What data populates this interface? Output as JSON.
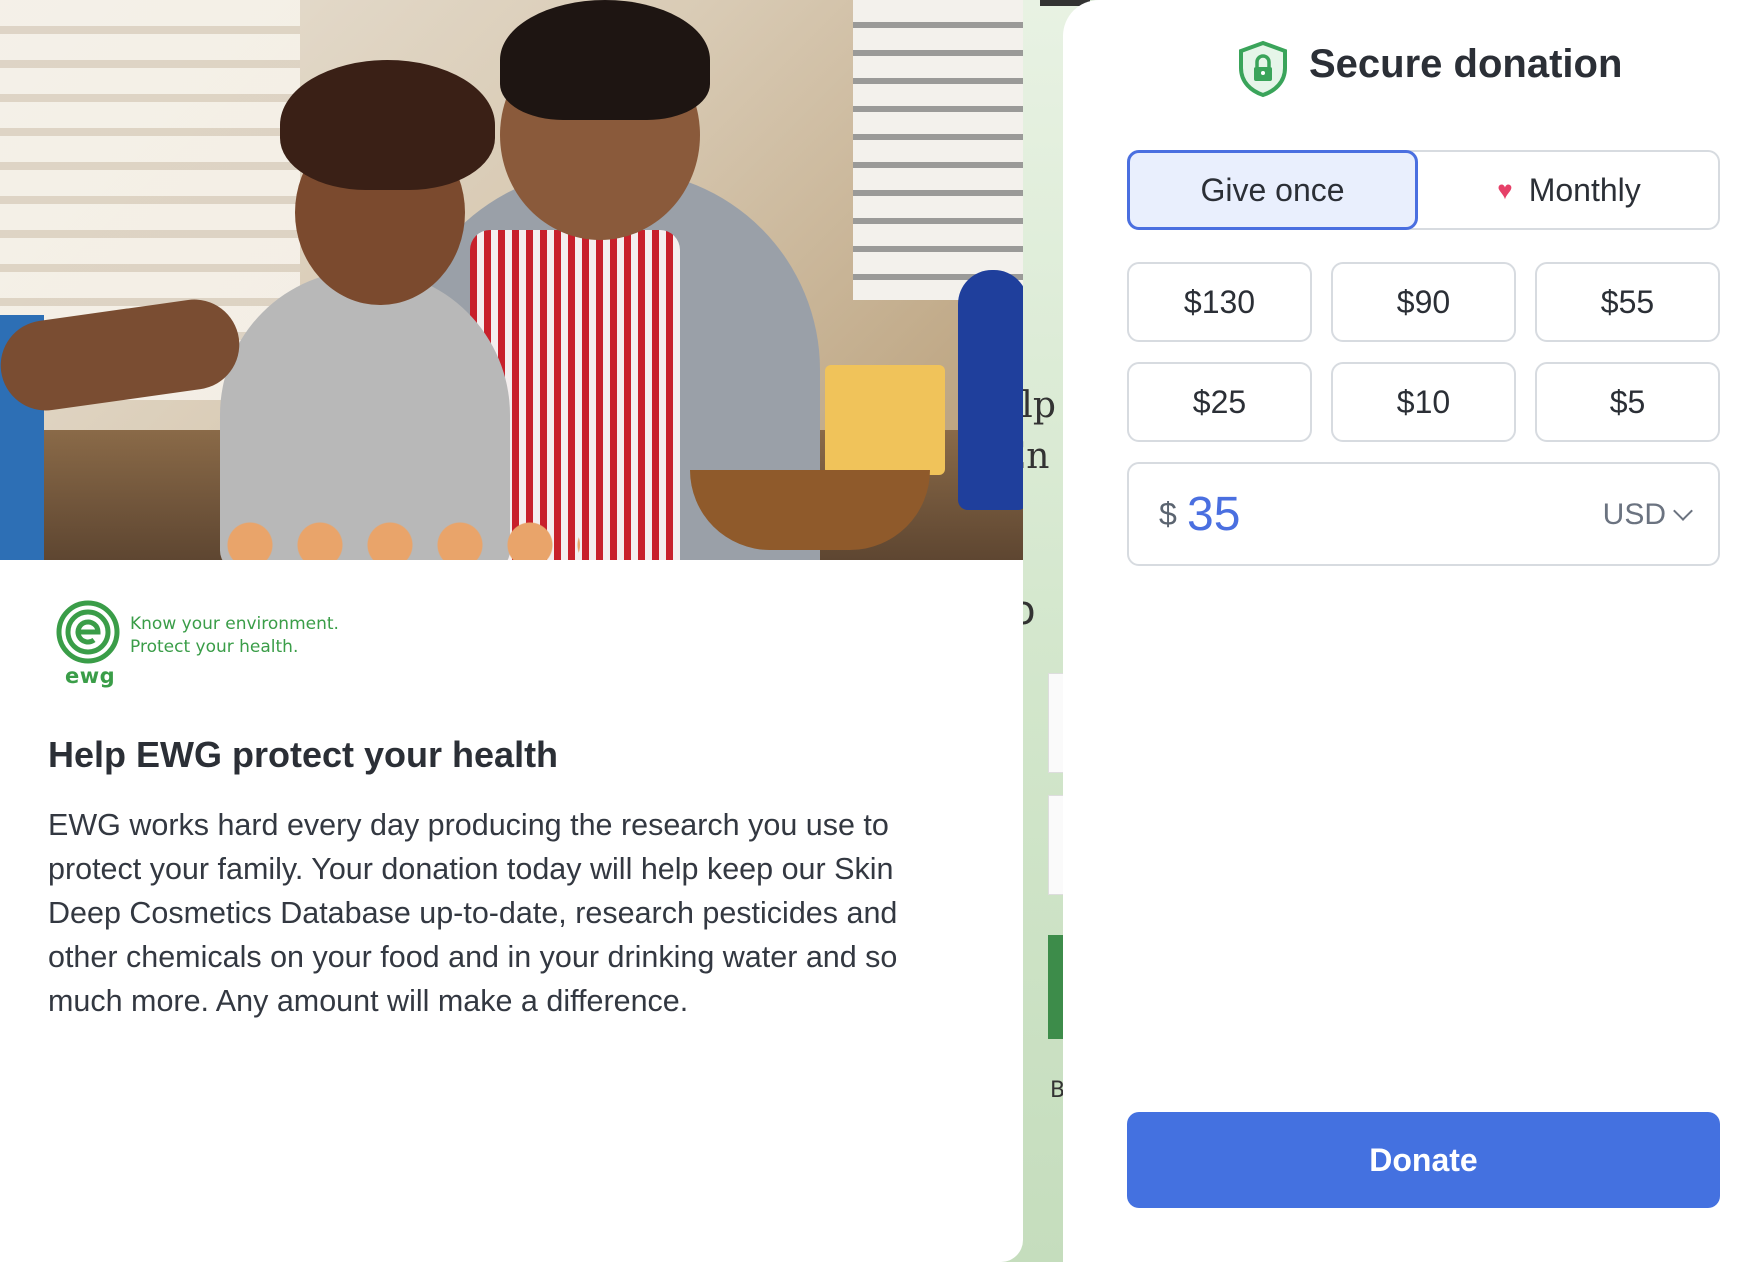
{
  "background_page": {
    "fragments": [
      "elp",
      "En",
      "lo",
      "B"
    ]
  },
  "story": {
    "hero_image": "parent-and-child-cooking-photo",
    "logo": {
      "word": "ewg",
      "tagline_line1": "Know your environment.",
      "tagline_line2": "Protect your health."
    },
    "title": "Help EWG protect your health",
    "body": "EWG works hard every day producing the research you use to protect your family. Your donation today will help keep our Skin Deep Cosmetics Database up-to-date, research pesticides and other chemicals on your food and in your drinking water and so much more. Any amount will make a difference."
  },
  "donation": {
    "title": "Secure donation",
    "icon": "shield-lock-icon",
    "frequency": {
      "once_label": "Give once",
      "monthly_label": "Monthly",
      "monthly_icon": "heart-icon",
      "selected": "once"
    },
    "amounts": [
      "$130",
      "$90",
      "$55",
      "$25",
      "$10",
      "$5"
    ],
    "custom": {
      "symbol": "$",
      "value": "35",
      "currency": "USD"
    },
    "donate_label": "Donate"
  },
  "colors": {
    "accent": "#4471e0",
    "brand_green": "#3a9d48",
    "heart": "#e64068",
    "selected_bg": "#e9effd"
  }
}
